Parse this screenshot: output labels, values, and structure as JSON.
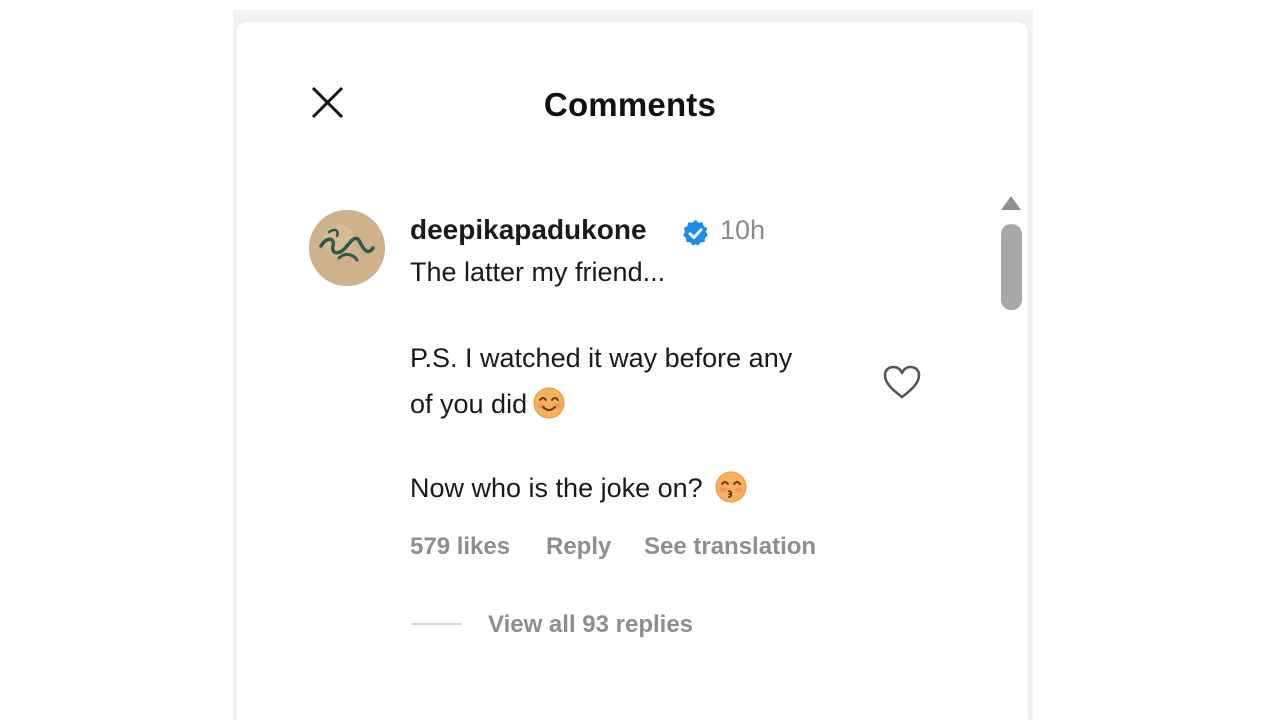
{
  "header": {
    "title": "Comments",
    "close_icon": "close-icon"
  },
  "comment": {
    "username": "deepikapadukone",
    "verified_icon": "verified-badge-icon",
    "time": "10h",
    "lines": [
      "The latter my friend...",
      "P.S. I watched it way before any",
      "of you did",
      "Now who is the joke on?"
    ],
    "emojis": [
      "smiling-face-with-smiling-eyes-emoji",
      "kissing-face-with-smiling-eyes-emoji"
    ],
    "likes": "579 likes",
    "reply_label": "Reply",
    "translation_label": "See translation",
    "like_icon": "heart-outline-icon",
    "view_replies": "View all 93 replies"
  },
  "colors": {
    "verified_blue": "#1f8be8",
    "muted_text": "#8e8e8e"
  }
}
